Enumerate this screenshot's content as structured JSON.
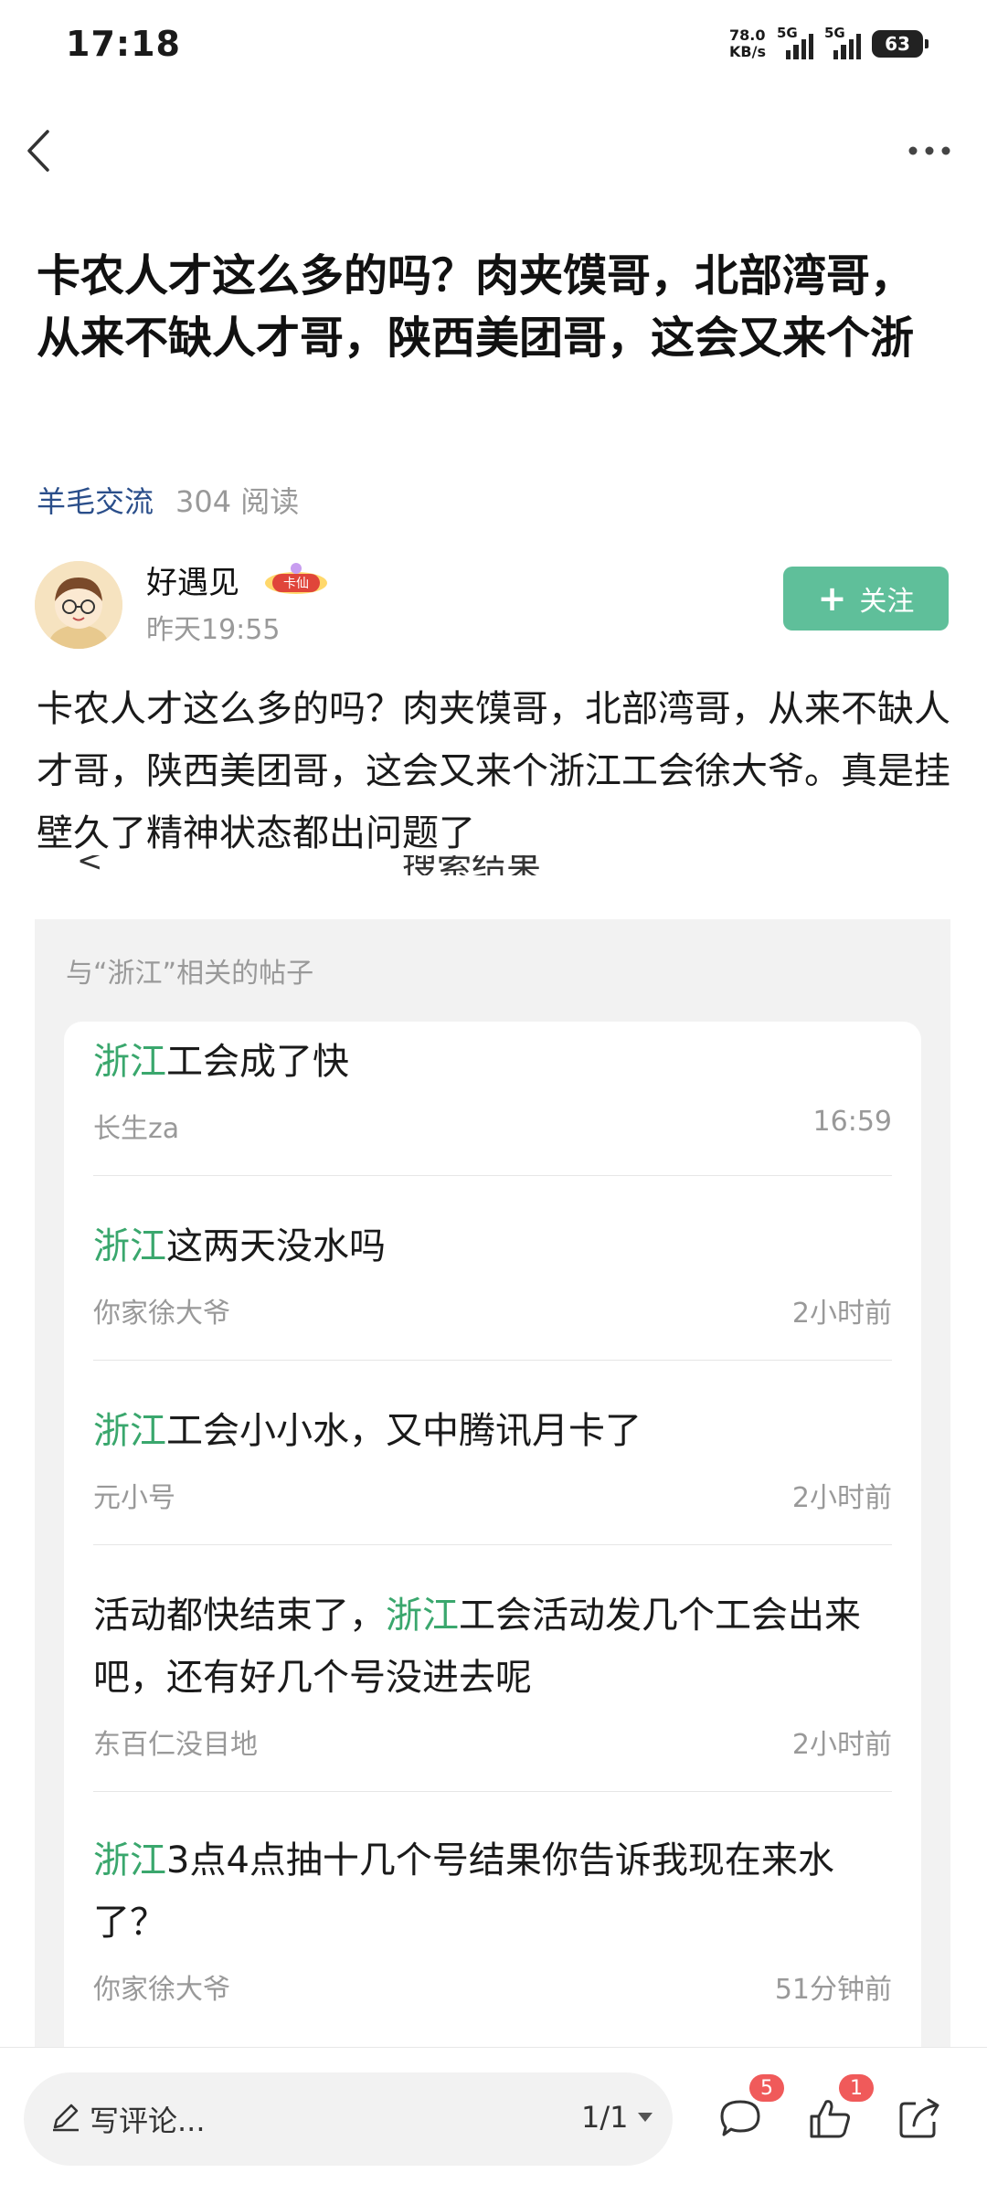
{
  "status_bar": {
    "time": "17:18",
    "net_speed_value": "78.0",
    "net_speed_unit": "KB/s",
    "signal1_label": "5G",
    "signal2_label": "5G",
    "battery": "63"
  },
  "post": {
    "title": "卡农人才这么多的吗？肉夹馍哥，北部湾哥，从来不缺人才哥，陕西美团哥，这会又来个浙",
    "category": "羊毛交流",
    "read_count": "304 阅读",
    "author": "好遇见",
    "badge_text": "卡仙",
    "time": "昨天19:55",
    "follow_label": "关注",
    "body": "卡农人才这么多的吗？肉夹馍哥，北部湾哥，从来不缺人才哥，陕西美团哥，这会又来个浙江工会徐大爷。真是挂壁久了精神状态都出问题了",
    "cutoff_text": "搜索结果"
  },
  "related": {
    "header": "与“浙江”相关的帖子",
    "highlight_keyword": "浙江",
    "items": [
      {
        "prefix": "",
        "keyword": "浙江",
        "suffix": "工会成了快",
        "author": "长生za",
        "time": "16:59"
      },
      {
        "prefix": "",
        "keyword": "浙江",
        "suffix": "这两天没水吗",
        "author": "你家徐大爷",
        "time": "2小时前"
      },
      {
        "prefix": "",
        "keyword": "浙江",
        "suffix": "工会小小水，又中腾讯月卡了",
        "author": "元小号",
        "time": "2小时前"
      },
      {
        "prefix": "活动都快结束了，",
        "keyword": "浙江",
        "suffix": "工会活动发几个工会出来吧，还有好几个号没进去呢",
        "author": "东百仁没目地",
        "time": "2小时前"
      },
      {
        "prefix": "",
        "keyword": "浙江",
        "suffix": "3点4点抽十几个号结果你告诉我现在来水了？",
        "author": "你家徐大爷",
        "time": "51分钟前"
      }
    ]
  },
  "bottom_bar": {
    "comment_placeholder": "写评论...",
    "page_indicator": "1/1",
    "comment_count": "5",
    "like_count": "1"
  },
  "colors": {
    "accent_green": "#3aa76d",
    "follow_button": "#5fbf9a",
    "category_blue": "#2a4e8a",
    "badge_red": "#f05a5a"
  },
  "icons": [
    "back-icon",
    "more-icon",
    "pen-icon",
    "dropdown-arrow-icon",
    "comment-icon",
    "like-icon",
    "share-icon"
  ]
}
